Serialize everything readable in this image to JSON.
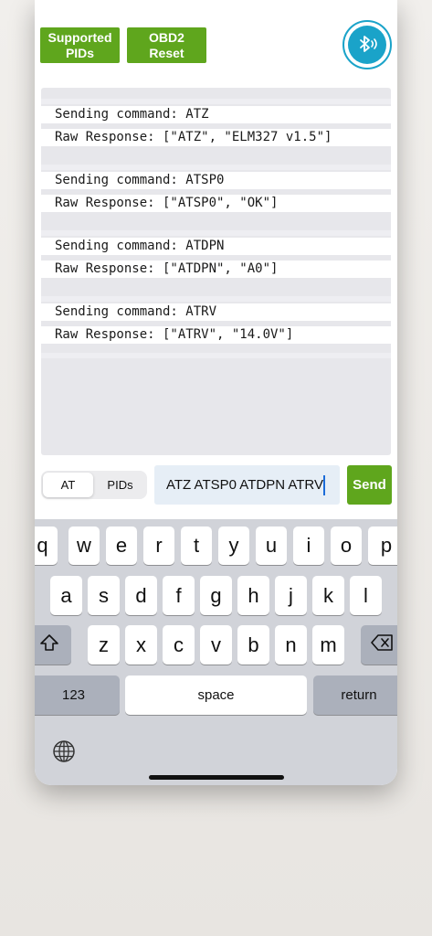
{
  "header": {
    "supported_pids_line1": "Supported",
    "supported_pids_line2": "PIDs",
    "obd2_reset_line1": "OBD2",
    "obd2_reset_line2": "Reset",
    "bluetooth_icon": "bluetooth-signal-icon",
    "accent_green": "#5fa61d",
    "accent_blue": "#1aa3c9"
  },
  "log": {
    "lines": [
      "Sending command: ATZ",
      "Raw Response: [\"ATZ\", \"ELM327 v1.5\"]",
      "Sending command: ATSP0",
      "Raw Response: [\"ATSP0\", \"OK\"]",
      "Sending command: ATDPN",
      "Raw Response: [\"ATDPN\", \"A0\"]",
      "Sending command: ATRV",
      "Raw Response: [\"ATRV\", \"14.0V\"]"
    ]
  },
  "controls": {
    "segment": {
      "options": [
        "AT",
        "PIDs"
      ],
      "selected": "AT"
    },
    "command_input_value": "ATZ ATSP0 ATDPN ATRV",
    "send_label": "Send"
  },
  "keyboard": {
    "row1": [
      "q",
      "w",
      "e",
      "r",
      "t",
      "y",
      "u",
      "i",
      "o",
      "p"
    ],
    "row2": [
      "a",
      "s",
      "d",
      "f",
      "g",
      "h",
      "j",
      "k",
      "l"
    ],
    "row3": [
      "z",
      "x",
      "c",
      "v",
      "b",
      "n",
      "m"
    ],
    "numbers_label": "123",
    "space_label": "space",
    "return_label": "return",
    "shift_icon": "shift-icon",
    "delete_icon": "delete-backward-icon",
    "globe_icon": "globe-icon"
  }
}
